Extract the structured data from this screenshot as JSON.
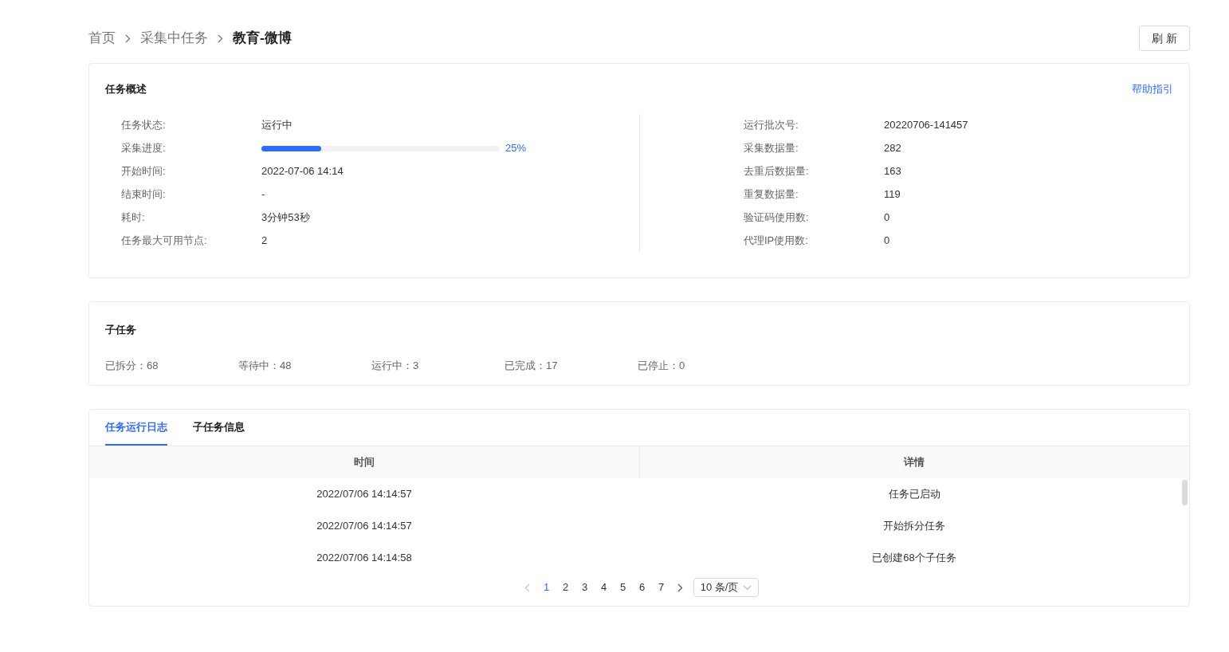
{
  "breadcrumb": [
    {
      "label": "首页",
      "current": false
    },
    {
      "label": "采集中任务",
      "current": false
    },
    {
      "label": "教育-微博",
      "current": true
    }
  ],
  "refresh_button": "刷 新",
  "overview": {
    "title": "任务概述",
    "help_link": "帮助指引",
    "left": [
      {
        "kind": "text",
        "label": "任务状态:",
        "value": "运行中"
      },
      {
        "kind": "progress",
        "label": "采集进度:",
        "level": 0.25,
        "reading": "25%"
      },
      {
        "kind": "text",
        "label": "开始时间:",
        "value": "2022-07-06 14:14"
      },
      {
        "kind": "text",
        "label": "结束时间:",
        "value": "-"
      },
      {
        "kind": "text",
        "label": "耗时:",
        "value": "3分钟53秒"
      },
      {
        "kind": "text",
        "label": "任务最大可用节点:",
        "value": "2"
      }
    ],
    "right": [
      {
        "kind": "text",
        "label": "运行批次号:",
        "value": "20220706-141457"
      },
      {
        "kind": "text",
        "label": "采集数据量:",
        "value": "282"
      },
      {
        "kind": "text",
        "label": "去重后数据量:",
        "value": "163"
      },
      {
        "kind": "text",
        "label": "重复数据量:",
        "value": "119"
      },
      {
        "kind": "text",
        "label": "验证码使用数:",
        "value": "0"
      },
      {
        "kind": "text",
        "label": "代理IP使用数:",
        "value": "0"
      }
    ]
  },
  "subtasks": {
    "title": "子任务",
    "stats": [
      {
        "label": "已拆分：",
        "value": "68"
      },
      {
        "label": "等待中：",
        "value": "48"
      },
      {
        "label": "运行中：",
        "value": "3"
      },
      {
        "label": "已完成：",
        "value": "17"
      },
      {
        "label": "已停止：",
        "value": "0"
      }
    ]
  },
  "tabs": [
    {
      "label": "任务运行日志",
      "selected": true
    },
    {
      "label": "子任务信息",
      "selected": false
    }
  ],
  "table": {
    "columns": [
      "时间",
      "详情"
    ],
    "rows": [
      [
        "2022/07/06 14:14:57",
        "任务已启动"
      ],
      [
        "2022/07/06 14:14:57",
        "开始拆分任务"
      ],
      [
        "2022/07/06 14:14:58",
        "已创建68个子任务"
      ]
    ]
  },
  "pagination": {
    "prev_disabled": true,
    "next_disabled": false,
    "pages": [
      {
        "label": "1",
        "selected": true
      },
      {
        "label": "2",
        "selected": false
      },
      {
        "label": "3",
        "selected": false
      },
      {
        "label": "4",
        "selected": false
      },
      {
        "label": "5",
        "selected": false
      },
      {
        "label": "6",
        "selected": false
      },
      {
        "label": "7",
        "selected": false
      }
    ],
    "page_size": "10 条/页"
  }
}
